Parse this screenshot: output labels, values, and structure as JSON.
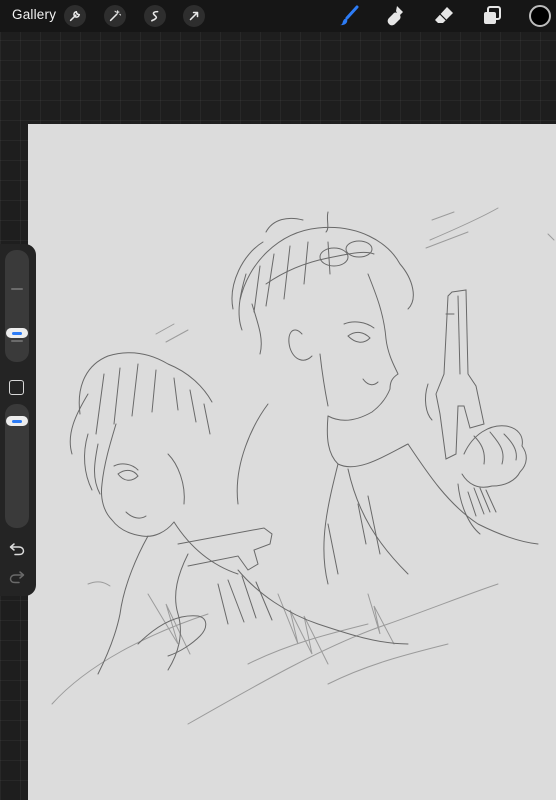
{
  "toolbar": {
    "gallery_label": "Gallery",
    "left_tools": [
      "wrench-icon",
      "magic-wand-icon",
      "selection-icon",
      "transform-arrow-icon"
    ],
    "right_tools": [
      "brush-icon",
      "smudge-icon",
      "eraser-icon",
      "layers-icon"
    ],
    "active_tool": "brush-icon",
    "accent_color": "#2d7cf6",
    "current_color": "#000000"
  },
  "sidebar": {
    "brush_size_level": 0.6,
    "opacity_level": 0.8,
    "modify_button": "modify-square-icon",
    "undo": "undo-icon",
    "redo": "redo-icon"
  },
  "canvas": {
    "background": "#dcdcdc",
    "content": "pencil-sketch"
  }
}
